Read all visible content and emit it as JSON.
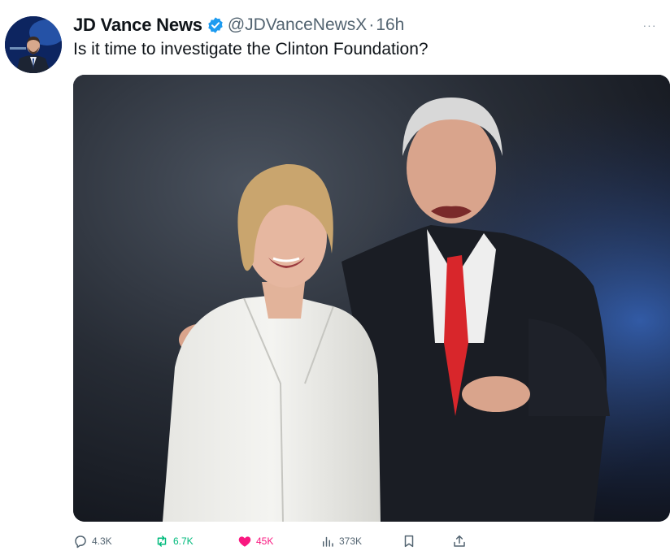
{
  "tweet": {
    "display_name": "JD Vance News",
    "handle": "@JDVanceNewsX",
    "separator": "·",
    "time": "16h",
    "more_label": "···",
    "text": "Is it time to investigate the Clinton Foundation?"
  },
  "actions": {
    "replies": "4.3K",
    "reposts": "6.7K",
    "likes": "45K",
    "views": "373K"
  },
  "icons": {
    "reply": "reply-icon",
    "repost": "repost-icon",
    "like": "heart-icon",
    "views": "views-icon",
    "bookmark": "bookmark-icon",
    "share": "share-icon",
    "verified": "verified-badge-icon"
  },
  "colors": {
    "verified": "#1d9bf0",
    "repost": "#00ba7c",
    "like": "#f91880",
    "muted": "#536471"
  }
}
